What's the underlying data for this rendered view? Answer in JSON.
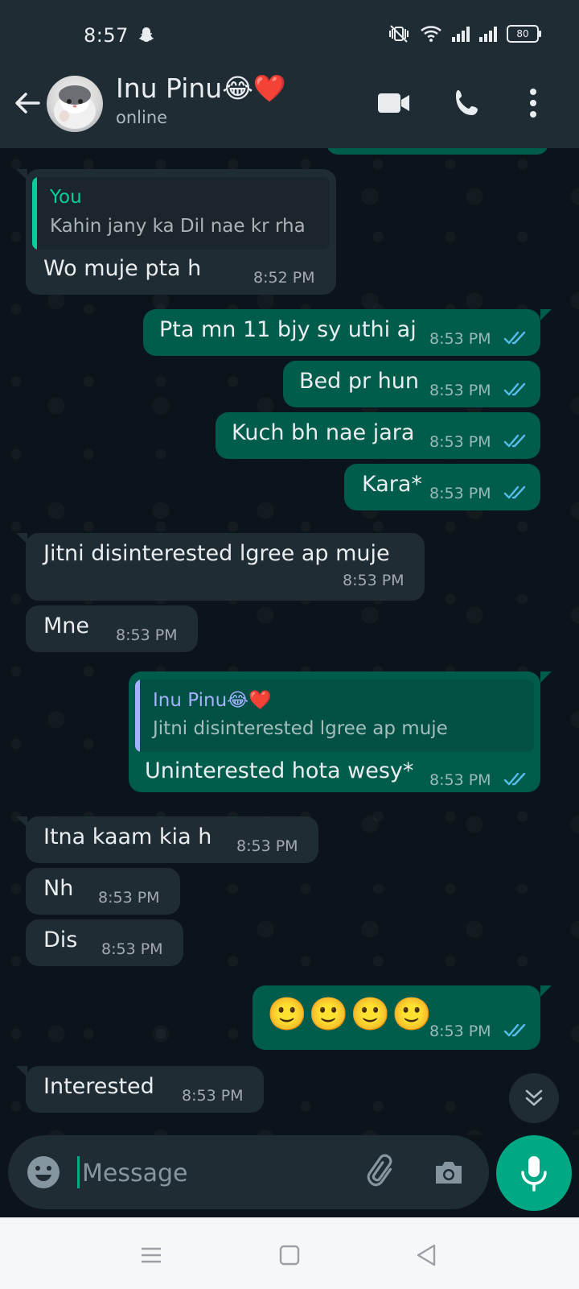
{
  "status_bar": {
    "time": "8:57",
    "battery": "80"
  },
  "header": {
    "contact_name": "Inu Pinu😂❤️",
    "contact_status": "online"
  },
  "messages": [
    {
      "dir": "in",
      "quote_author": "You",
      "quote_text": "Kahin jany ka Dil nae kr rha",
      "text": "Wo muje pta h",
      "time": "8:52 PM"
    },
    {
      "dir": "out",
      "text": "Pta mn 11 bjy sy uthi aj",
      "time": "8:53 PM"
    },
    {
      "dir": "out",
      "text": "Bed pr hun",
      "time": "8:53 PM"
    },
    {
      "dir": "out",
      "text": "Kuch bh nae jara",
      "time": "8:53 PM"
    },
    {
      "dir": "out",
      "text": "Kara*",
      "time": "8:53 PM"
    },
    {
      "dir": "in",
      "text": "Jitni disinterested lgree ap muje",
      "time": "8:53 PM"
    },
    {
      "dir": "in",
      "text": "Mne",
      "time": "8:53 PM"
    },
    {
      "dir": "out",
      "quote_author": "Inu Pinu😂❤️",
      "quote_text": "Jitni disinterested lgree ap muje",
      "text": "Uninterested hota wesy*",
      "time": "8:53 PM"
    },
    {
      "dir": "in",
      "text": "Itna kaam kia h",
      "time": "8:53 PM"
    },
    {
      "dir": "in",
      "text": "Nh",
      "time": "8:53 PM"
    },
    {
      "dir": "in",
      "text": "Dis",
      "time": "8:53 PM"
    },
    {
      "dir": "out",
      "text": "🙂🙂🙂🙂",
      "time": "8:53 PM"
    },
    {
      "dir": "in",
      "text": "Interested",
      "time": "8:53 PM"
    }
  ],
  "input": {
    "placeholder": "Message"
  },
  "colors": {
    "accent": "#00a884",
    "outgoing": "#005c4b",
    "incoming": "#1f2c34",
    "read_ticks": "#53bdeb"
  }
}
